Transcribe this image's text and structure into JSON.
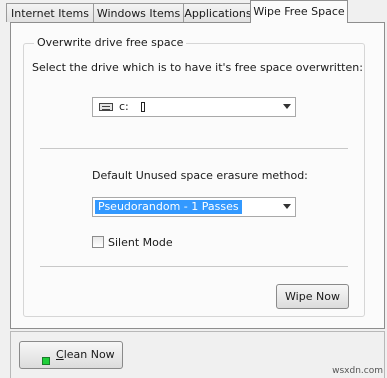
{
  "tabs": [
    {
      "label": "Internet Items",
      "active": false
    },
    {
      "label": "Windows Items",
      "active": false
    },
    {
      "label": "Applications",
      "active": false
    },
    {
      "label": "Wipe Free Space",
      "active": true
    }
  ],
  "group": {
    "title": "Overwrite drive free space",
    "drive_prompt": "Select the drive which is to have it's free space overwritten:",
    "drive_value": "c:",
    "method_label": "Default Unused space erasure method:",
    "method_value": "Pseudorandom - 1 Passes",
    "silent_mode_label": "Silent Mode",
    "silent_mode_checked": false,
    "wipe_button": "Wipe Now"
  },
  "footer": {
    "clean_button_underlined": "C",
    "clean_button_rest": "lean Now"
  },
  "watermark": "wsxdn.com",
  "colors": {
    "selection": "#3399ff",
    "led": "#1fcf3a"
  }
}
